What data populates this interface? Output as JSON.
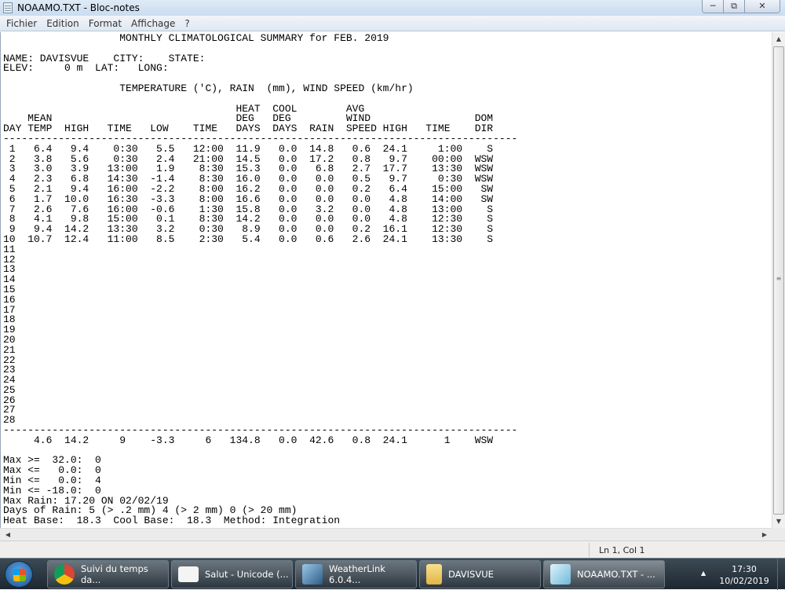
{
  "window": {
    "title": "NOAAMO.TXT - Bloc-notes"
  },
  "menu": [
    "Fichier",
    "Edition",
    "Format",
    "Affichage",
    "?"
  ],
  "document": {
    "header_lines": [
      "                   MONTHLY CLIMATOLOGICAL SUMMARY for FEB. 2019",
      "",
      "NAME: DAVISVUE    CITY:    STATE:",
      "ELEV:     0 m  LAT:   LONG:",
      "",
      "                   TEMPERATURE ('C), RAIN  (mm), WIND SPEED (km/hr)",
      "",
      "                                      HEAT  COOL        AVG",
      "    MEAN                              DEG   DEG         WIND                 DOM",
      "DAY TEMP  HIGH   TIME   LOW    TIME   DAYS  DAYS  RAIN  SPEED HIGH   TIME    DIR",
      "------------------------------------------------------------------------------------"
    ],
    "rows": [
      [
        "1",
        "6.4",
        "9.4",
        "0:30",
        "5.5",
        "12:00",
        "11.9",
        "0.0",
        "14.8",
        "0.6",
        "24.1",
        "1:00",
        "S"
      ],
      [
        "2",
        "3.8",
        "5.6",
        "0:30",
        "2.4",
        "21:00",
        "14.5",
        "0.0",
        "17.2",
        "0.8",
        "9.7",
        "00:00",
        "WSW"
      ],
      [
        "3",
        "3.0",
        "3.9",
        "13:00",
        "1.9",
        "8:30",
        "15.3",
        "0.0",
        "6.8",
        "2.7",
        "17.7",
        "13:30",
        "WSW"
      ],
      [
        "4",
        "2.3",
        "6.8",
        "14:30",
        "-1.4",
        "8:30",
        "16.0",
        "0.0",
        "0.0",
        "0.5",
        "9.7",
        "0:30",
        "WSW"
      ],
      [
        "5",
        "2.1",
        "9.4",
        "16:00",
        "-2.2",
        "8:00",
        "16.2",
        "0.0",
        "0.0",
        "0.2",
        "6.4",
        "15:00",
        "SW"
      ],
      [
        "6",
        "1.7",
        "10.0",
        "16:30",
        "-3.3",
        "8:00",
        "16.6",
        "0.0",
        "0.0",
        "0.0",
        "4.8",
        "14:00",
        "SW"
      ],
      [
        "7",
        "2.6",
        "7.6",
        "16:00",
        "-0.6",
        "1:30",
        "15.8",
        "0.0",
        "3.2",
        "0.0",
        "4.8",
        "13:00",
        "S"
      ],
      [
        "8",
        "4.1",
        "9.8",
        "15:00",
        "0.1",
        "8:30",
        "14.2",
        "0.0",
        "0.0",
        "0.0",
        "4.8",
        "12:30",
        "S"
      ],
      [
        "9",
        "9.4",
        "14.2",
        "13:30",
        "3.2",
        "0:30",
        "8.9",
        "0.0",
        "0.0",
        "0.2",
        "16.1",
        "12:30",
        "S"
      ],
      [
        "10",
        "10.7",
        "12.4",
        "11:00",
        "8.5",
        "2:30",
        "5.4",
        "0.0",
        "0.6",
        "2.6",
        "24.1",
        "13:30",
        "S"
      ],
      [
        "11"
      ],
      [
        "12"
      ],
      [
        "13"
      ],
      [
        "14"
      ],
      [
        "15"
      ],
      [
        "16"
      ],
      [
        "17"
      ],
      [
        "18"
      ],
      [
        "19"
      ],
      [
        "20"
      ],
      [
        "21"
      ],
      [
        "22"
      ],
      [
        "23"
      ],
      [
        "24"
      ],
      [
        "25"
      ],
      [
        "26"
      ],
      [
        "27"
      ],
      [
        "28"
      ]
    ],
    "separator": "------------------------------------------------------------------------------------",
    "totals": [
      "4.6",
      "14.2",
      "9",
      "-3.3",
      "6",
      "134.8",
      "0.0",
      "42.6",
      "0.8",
      "24.1",
      "1",
      "WSW"
    ],
    "footer_lines": [
      "",
      "Max >=  32.0:  0",
      "Max <=   0.0:  0",
      "Min <=   0.0:  4",
      "Min <= -18.0:  0",
      "Max Rain: 17.20 ON 02/02/19",
      "Days of Rain: 5 (> .2 mm) 4 (> 2 mm) 0 (> 20 mm)",
      "Heat Base:  18.3  Cool Base:  18.3  Method: Integration"
    ]
  },
  "statusbar": {
    "position": "Ln 1, Col 1"
  },
  "taskbar": {
    "items": [
      {
        "label": "Suivi du temps da...",
        "icon": "chrome-icon"
      },
      {
        "label": "Salut - Unicode (...",
        "icon": "mail-icon"
      },
      {
        "label": "WeatherLink 6.0.4...",
        "icon": "weatherlink-icon"
      },
      {
        "label": "DAVISVUE",
        "icon": "folder-icon"
      },
      {
        "label": "NOAAMO.TXT - ...",
        "icon": "notepad-icon"
      }
    ],
    "clock_time": "17:30",
    "clock_date": "10/02/2019"
  }
}
